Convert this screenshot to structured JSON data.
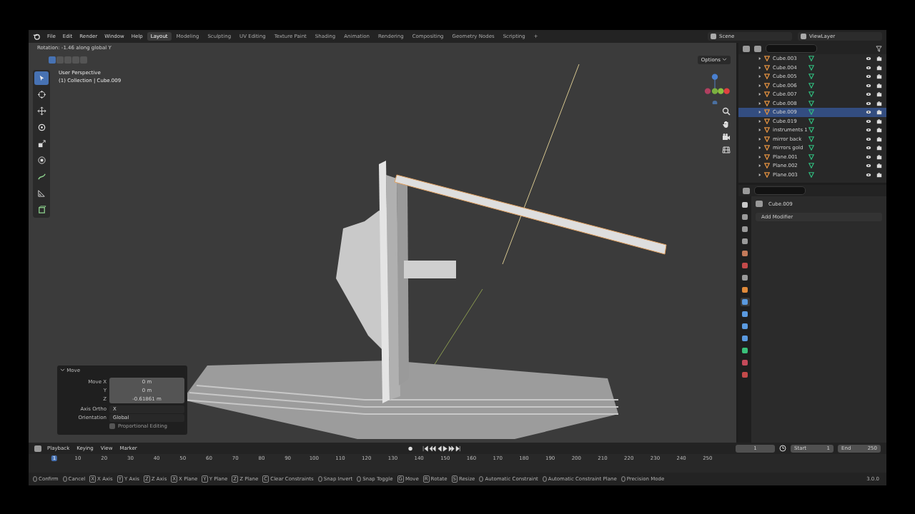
{
  "menu": [
    "File",
    "Edit",
    "Render",
    "Window",
    "Help"
  ],
  "workspaces": [
    {
      "label": "Layout",
      "selected": true
    },
    {
      "label": "Modeling",
      "selected": false
    },
    {
      "label": "Sculpting",
      "selected": false
    },
    {
      "label": "UV Editing",
      "selected": false
    },
    {
      "label": "Texture Paint",
      "selected": false
    },
    {
      "label": "Shading",
      "selected": false
    },
    {
      "label": "Animation",
      "selected": false
    },
    {
      "label": "Rendering",
      "selected": false
    },
    {
      "label": "Compositing",
      "selected": false
    },
    {
      "label": "Geometry Nodes",
      "selected": false
    },
    {
      "label": "Scripting",
      "selected": false
    }
  ],
  "add_workspace": "+",
  "scene": "Scene",
  "view_layer": "ViewLayer",
  "viewport": {
    "operator_hint": "Rotation: -1.46 along global Y",
    "view_name": "User Perspective",
    "collection": "(1) Collection | Cube.009",
    "options": "Options",
    "select_modes": [
      {
        "selected": true
      },
      {
        "selected": false
      },
      {
        "selected": false
      },
      {
        "selected": false
      },
      {
        "selected": false
      }
    ],
    "tools": [
      {
        "kind": "select",
        "selected": true
      },
      {
        "kind": "cursor",
        "selected": false
      },
      {
        "kind": "move",
        "selected": false
      },
      {
        "kind": "rotate",
        "selected": false
      },
      {
        "kind": "scale",
        "selected": false
      },
      {
        "kind": "transform",
        "selected": false
      },
      {
        "kind": "annotate",
        "selected": false
      },
      {
        "kind": "measure",
        "selected": false
      },
      {
        "kind": "add",
        "selected": false
      }
    ]
  },
  "last_operator": {
    "title": "Move",
    "fields": [
      {
        "label": "Move X",
        "value": "0 m"
      },
      {
        "label": "Y",
        "value": "0 m"
      },
      {
        "label": "Z",
        "value": "-0.61861 m"
      }
    ],
    "axis_ortho": {
      "label": "Axis Ortho",
      "value": "X"
    },
    "orientation": {
      "label": "Orientation",
      "value": "Global"
    },
    "proportional": {
      "label": "Proportional Editing",
      "checked": false
    }
  },
  "outliner": {
    "items": [
      {
        "name": "Cube.003",
        "selected": false
      },
      {
        "name": "Cube.004",
        "selected": false
      },
      {
        "name": "Cube.005",
        "selected": false
      },
      {
        "name": "Cube.006",
        "selected": false
      },
      {
        "name": "Cube.007",
        "selected": false
      },
      {
        "name": "Cube.008",
        "selected": false
      },
      {
        "name": "Cube.009",
        "selected": true
      },
      {
        "name": "Cube.019",
        "selected": false
      },
      {
        "name": "instruments 1",
        "selected": false
      },
      {
        "name": "mirror back",
        "selected": false
      },
      {
        "name": "mirrors gold",
        "selected": false
      },
      {
        "name": "Plane.001",
        "selected": false
      },
      {
        "name": "Plane.002",
        "selected": false
      },
      {
        "name": "Plane.003",
        "selected": false
      }
    ]
  },
  "properties": {
    "object": "Cube.009",
    "add_modifier": "Add Modifier",
    "tabs": [
      {
        "color": "#c8c8c8",
        "selected": false
      },
      {
        "color": "#9a9a9a",
        "selected": false
      },
      {
        "color": "#9a9a9a",
        "selected": false
      },
      {
        "color": "#9a9a9a",
        "selected": false
      },
      {
        "color": "#c47a5a",
        "selected": false
      },
      {
        "color": "#c44a4a",
        "selected": false
      },
      {
        "color": "#9a9a9a",
        "selected": false
      },
      {
        "color": "#e08a3a",
        "selected": false
      },
      {
        "color": "#5a9ae0",
        "selected": true
      },
      {
        "color": "#5a9ae0",
        "selected": false
      },
      {
        "color": "#5a9ae0",
        "selected": false
      },
      {
        "color": "#5a9ae0",
        "selected": false
      },
      {
        "color": "#3ac07a",
        "selected": false
      },
      {
        "color": "#c44a5a",
        "selected": false
      },
      {
        "color": "#c44a4a",
        "selected": false
      }
    ]
  },
  "timeline": {
    "menus": [
      "Playback",
      "Keying",
      "View",
      "Marker"
    ],
    "current_frame": "1",
    "start_label": "Start",
    "start": "1",
    "end_label": "End",
    "end": "250",
    "ticks": [
      {
        "label": "1",
        "selected": true
      },
      {
        "label": "10",
        "selected": false
      },
      {
        "label": "20",
        "selected": false
      },
      {
        "label": "30",
        "selected": false
      },
      {
        "label": "40",
        "selected": false
      },
      {
        "label": "50",
        "selected": false
      },
      {
        "label": "60",
        "selected": false
      },
      {
        "label": "70",
        "selected": false
      },
      {
        "label": "80",
        "selected": false
      },
      {
        "label": "90",
        "selected": false
      },
      {
        "label": "100",
        "selected": false
      },
      {
        "label": "110",
        "selected": false
      },
      {
        "label": "120",
        "selected": false
      },
      {
        "label": "130",
        "selected": false
      },
      {
        "label": "140",
        "selected": false
      },
      {
        "label": "150",
        "selected": false
      },
      {
        "label": "160",
        "selected": false
      },
      {
        "label": "170",
        "selected": false
      },
      {
        "label": "180",
        "selected": false
      },
      {
        "label": "190",
        "selected": false
      },
      {
        "label": "200",
        "selected": false
      },
      {
        "label": "210",
        "selected": false
      },
      {
        "label": "220",
        "selected": false
      },
      {
        "label": "230",
        "selected": false
      },
      {
        "label": "240",
        "selected": false
      },
      {
        "label": "250",
        "selected": false
      }
    ]
  },
  "status_bar": {
    "items": [
      {
        "label": "Confirm"
      },
      {
        "label": "Cancel"
      },
      {
        "key": "X",
        "label": "X Axis"
      },
      {
        "key": "Y",
        "label": "Y Axis"
      },
      {
        "key": "Z",
        "label": "Z Axis"
      },
      {
        "key": "X",
        "label": "X Plane"
      },
      {
        "key": "Y",
        "label": "Y Plane"
      },
      {
        "key": "Z",
        "label": "Z Plane"
      },
      {
        "key": "C",
        "label": "Clear Constraints"
      },
      {
        "label": "Snap Invert"
      },
      {
        "label": "Snap Toggle"
      },
      {
        "key": "G",
        "label": "Move"
      },
      {
        "key": "R",
        "label": "Rotate"
      },
      {
        "key": "S",
        "label": "Resize"
      },
      {
        "label": "Automatic Constraint"
      },
      {
        "label": "Automatic Constraint Plane"
      },
      {
        "label": "Precision Mode"
      }
    ],
    "version": "3.0.0"
  }
}
